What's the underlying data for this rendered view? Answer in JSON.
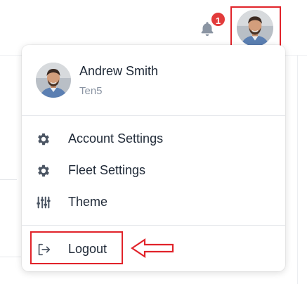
{
  "header": {
    "notification_count": "1",
    "notification_icon": "bell-icon",
    "avatar_icon": "user-avatar"
  },
  "user": {
    "name": "Andrew Smith",
    "org": "Ten5"
  },
  "menu": {
    "items": [
      {
        "label": "Account Settings",
        "icon": "gear-icon"
      },
      {
        "label": "Fleet Settings",
        "icon": "gear-icon"
      },
      {
        "label": "Theme",
        "icon": "sliders-icon"
      }
    ],
    "logout_label": "Logout",
    "logout_icon": "logout-icon"
  },
  "colors": {
    "highlight": "#e1232a",
    "badge": "#e23b3b",
    "icon": "#4b5563",
    "muted_text": "#8a94a3"
  }
}
